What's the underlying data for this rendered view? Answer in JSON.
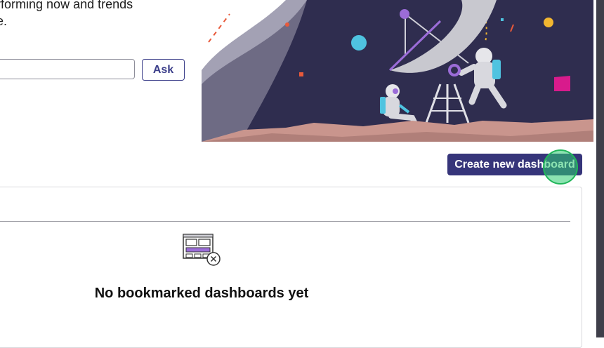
{
  "intro": {
    "line1": "e performing now and trends",
    "line2": "r time."
  },
  "ask": {
    "input_value": "",
    "button_label": "Ask"
  },
  "dashboards": {
    "create_button_label": "Create new dashboard",
    "empty_message": "No bookmarked dashboards yet"
  },
  "icons": {
    "illustration": "astronauts-satellite-illustration",
    "empty_state": "dashboard-remove-icon"
  },
  "colors": {
    "primary": "#36357a",
    "accent_purple": "#8a5cd1",
    "click_marker": "#2ecc71"
  }
}
